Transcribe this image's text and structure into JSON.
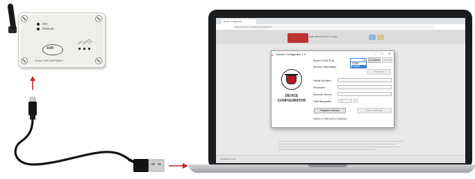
{
  "device": {
    "led_labels": [
      "ON",
      "Network"
    ],
    "side_labels": [
      "ETH",
      "SPEED",
      "USB"
    ],
    "logo": "cell",
    "model": "ersys CAN-WNP3i083"
  },
  "colors": {
    "arrow": "#cc2222",
    "accent_blue": "#3c7fd6",
    "logo_red": "#b31c1c"
  },
  "browser": {
    "tab_title": "Device Configurator",
    "address": "https://example.local/device-configurator",
    "site_title": "Rattle Barrie Monitor for Cargo",
    "status_text": "Configurator.exe"
  },
  "dialog": {
    "title": "Device Configurator 1.0",
    "window_buttons": [
      "–",
      "□",
      "✕"
    ],
    "brand_line1": "DEVICE",
    "brand_line2": "CONFIGURATOR",
    "select_com_label": "Select COM Port",
    "com_options": [
      "COM4",
      "COM10"
    ],
    "com_selected_index": 1,
    "connect_button": "Connect",
    "cancel_button": "Cancel",
    "device_info_label": "Device Information",
    "refresh_button": "Refresh",
    "serial_label": "Serial Number:",
    "firmware_label": "Firmware:",
    "remote_server_label": "Remote Server:",
    "can_baud_label": "CAN Baudrate:",
    "can_baud_value": "50",
    "register_button": "Register device",
    "save_button": "Save settings",
    "hint": "Select a COM port to continue."
  }
}
